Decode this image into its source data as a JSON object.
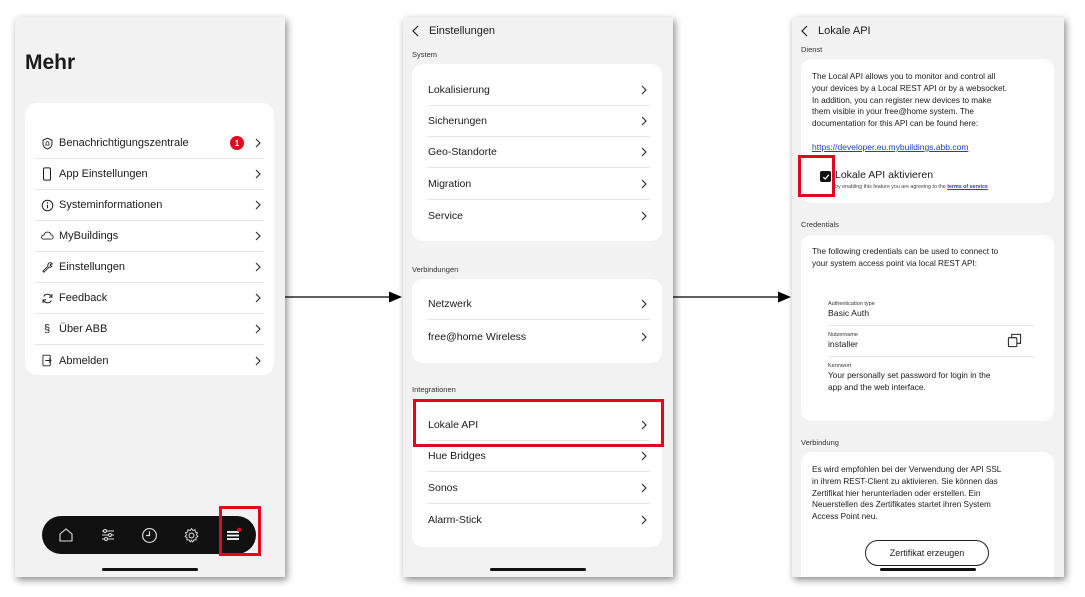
{
  "screen1": {
    "title": "Mehr",
    "badge": "1",
    "items": [
      {
        "label": "Benachrichtigungszentrale",
        "icon": "bell-shield-icon"
      },
      {
        "label": "App Einstellungen",
        "icon": "phone-icon"
      },
      {
        "label": "Systeminformationen",
        "icon": "info-icon"
      },
      {
        "label": "MyBuildings",
        "icon": "cloud-icon"
      },
      {
        "label": "Einstellungen",
        "icon": "wrench-icon"
      },
      {
        "label": "Feedback",
        "icon": "refresh-icon"
      },
      {
        "label": "Über ABB",
        "icon": "paragraph-icon"
      },
      {
        "label": "Abmelden",
        "icon": "logout-icon"
      }
    ],
    "tabbar": [
      "home-icon",
      "sliders-icon",
      "clock-icon",
      "gear-icon",
      "menu-icon"
    ]
  },
  "screen2": {
    "header": "Einstellungen",
    "sections": [
      {
        "label": "System",
        "items": [
          "Lokalisierung",
          "Sicherungen",
          "Geo-Standorte",
          "Migration",
          "Service"
        ]
      },
      {
        "label": "Verbindungen",
        "items": [
          "Netzwerk",
          "free@home Wireless"
        ]
      },
      {
        "label": "Integrationen",
        "items": [
          "Lokale API",
          "Hue Bridges",
          "Sonos",
          "Alarm-Stick"
        ]
      }
    ]
  },
  "screen3": {
    "header": "Lokale API",
    "dienst": {
      "label": "Dienst",
      "lines": [
        "The Local API allows you to monitor and control all",
        "your devices by a Local REST API or by a websocket.",
        "In addition, you can register new devices to make",
        "them visible in your free@home system. The",
        "documentation for this API can be found here:"
      ],
      "link": "https://developer.eu.mybuildings.abb.com",
      "checkbox_label": "Lokale API aktivieren",
      "checkbox_hint": "by enabling this feature you are agreeing to the",
      "terms_link": "terms of service"
    },
    "credentials": {
      "label": "Credentials",
      "intro_lines": [
        "The following credentials can be used to connect to",
        "your system access point via local REST API:"
      ],
      "auth_type_label": "Authentication type",
      "auth_type_value": "Basic Auth",
      "user_label": "Nutzername",
      "user_value": "installer",
      "password_label": "Kennwort",
      "password_lines": [
        "Your personally set password for login in the",
        "app and the web interface."
      ]
    },
    "verbindung": {
      "label": "Verbindung",
      "lines": [
        "Es wird empfohlen bei der Verwendung der API SSL",
        "in ihrem REST-Client zu aktivieren. Sie können das",
        "Zertifikat hier herunterladen oder erstellen. Ein",
        "Neuerstellen des Zertifikates startet ihren System",
        "Access Point neu."
      ],
      "button": "Zertifikat erzeugen"
    }
  },
  "colors": {
    "highlight": "#e3061f",
    "badge": "#e3061f",
    "link": "#1a3ddb",
    "background": "#f2f2f2"
  }
}
